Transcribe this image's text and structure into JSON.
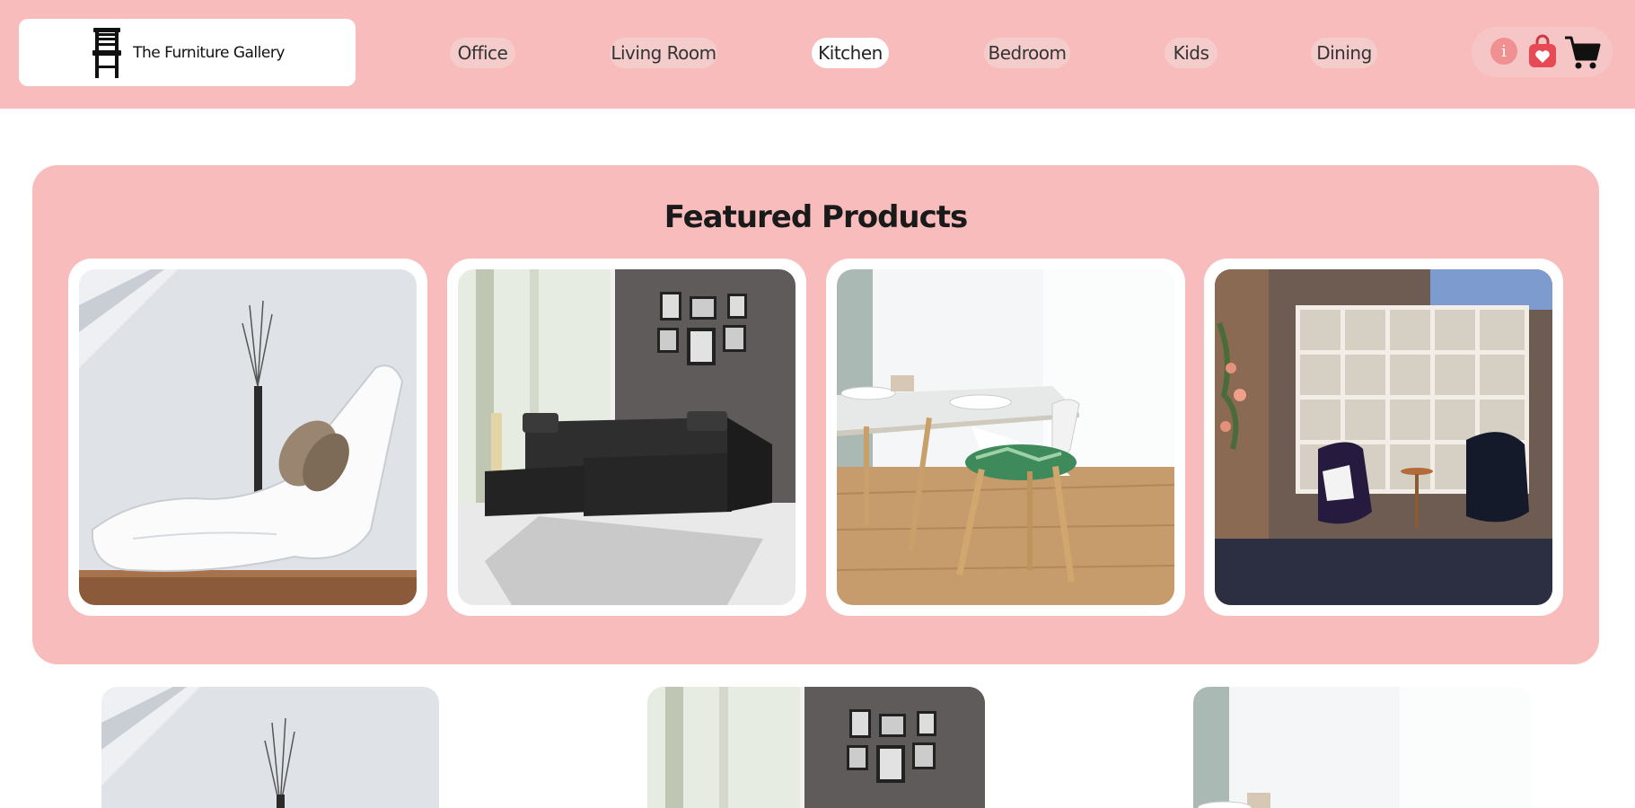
{
  "brand": {
    "name": "The Furniture Gallery",
    "logo_icon": "chair-icon"
  },
  "nav": [
    {
      "label": "Office",
      "active": false
    },
    {
      "label": "Living Room",
      "active": false
    },
    {
      "label": "Kitchen",
      "active": true
    },
    {
      "label": "Bedroom",
      "active": false
    },
    {
      "label": "Kids",
      "active": false
    },
    {
      "label": "Dining",
      "active": false
    }
  ],
  "actions": {
    "info_glyph": "i",
    "icons": [
      "info-icon",
      "shopping-bag-heart-icon",
      "cart-icon"
    ]
  },
  "featured": {
    "title": "Featured Products",
    "products": [
      {
        "image": "white-chaise-lounge-photo"
      },
      {
        "image": "black-sectional-sofa-photo"
      },
      {
        "image": "dining-table-chairs-photo"
      },
      {
        "image": "shelving-armchairs-photo"
      }
    ]
  },
  "gallery": [
    {
      "image": "white-chaise-lounge-photo"
    },
    {
      "image": "black-sectional-sofa-photo"
    },
    {
      "image": "dining-table-chairs-photo"
    }
  ],
  "colors": {
    "header_bg": "#f8bcbc",
    "nav_pill": "#f5cccc",
    "active_pill": "#ffffff",
    "accent": "#e84a55"
  }
}
